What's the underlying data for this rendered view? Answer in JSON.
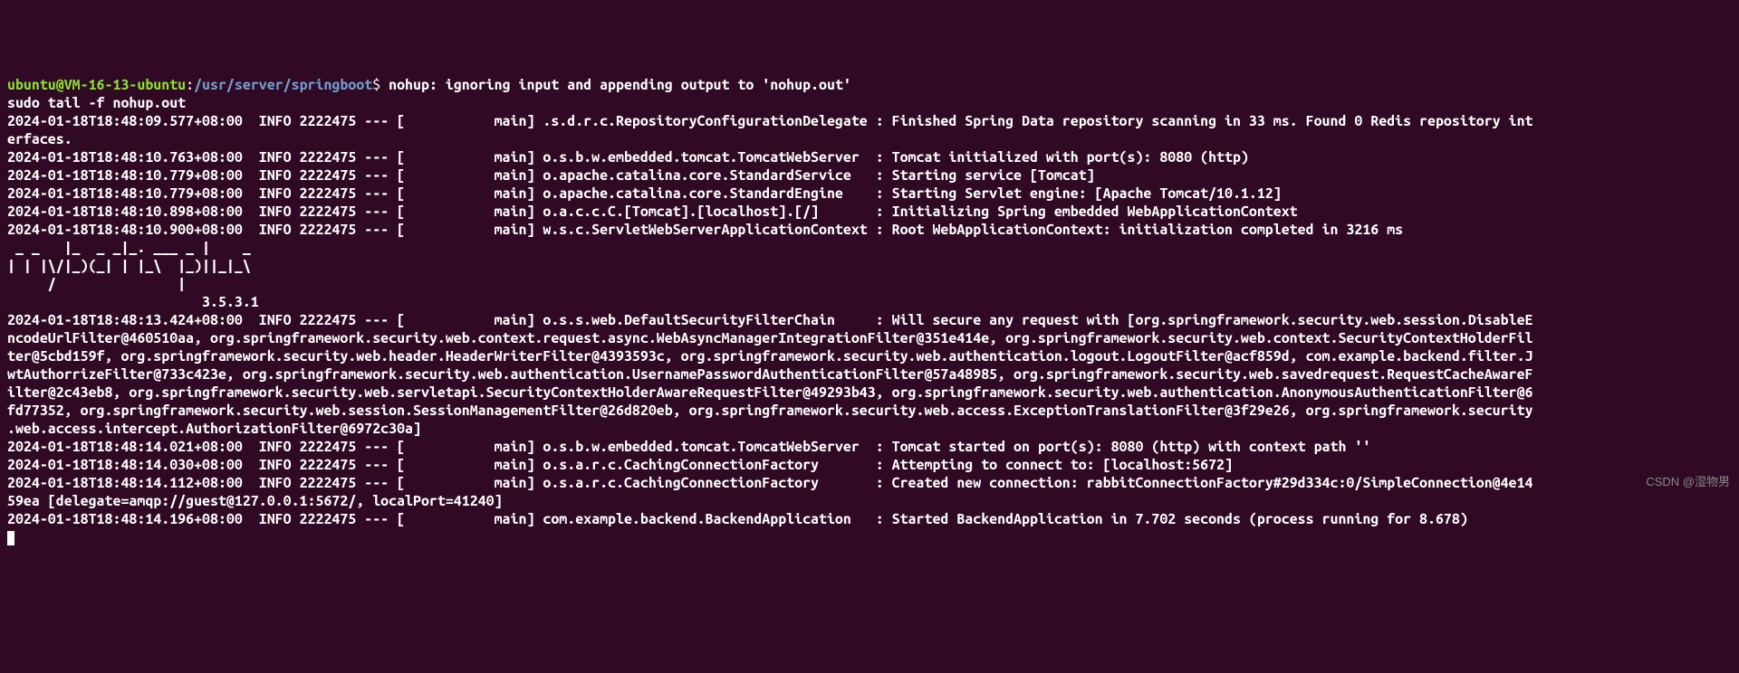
{
  "prompt": {
    "user": "ubuntu@VM-16-13-ubuntu",
    "colon": ":",
    "path": "/usr/server/springboot",
    "dollar": "$ ",
    "command": "nohup: ignoring input and appending output to 'nohup.out'"
  },
  "lines": [
    "sudo tail -f nohup.out",
    "2024-01-18T18:48:09.577+08:00  INFO 2222475 --- [           main] .s.d.r.c.RepositoryConfigurationDelegate : Finished Spring Data repository scanning in 33 ms. Found 0 Redis repository int",
    "erfaces.",
    "2024-01-18T18:48:10.763+08:00  INFO 2222475 --- [           main] o.s.b.w.embedded.tomcat.TomcatWebServer  : Tomcat initialized with port(s): 8080 (http)",
    "2024-01-18T18:48:10.779+08:00  INFO 2222475 --- [           main] o.apache.catalina.core.StandardService   : Starting service [Tomcat]",
    "2024-01-18T18:48:10.779+08:00  INFO 2222475 --- [           main] o.apache.catalina.core.StandardEngine    : Starting Servlet engine: [Apache Tomcat/10.1.12]",
    "2024-01-18T18:48:10.898+08:00  INFO 2222475 --- [           main] o.a.c.c.C.[Tomcat].[localhost].[/]       : Initializing Spring embedded WebApplicationContext",
    "2024-01-18T18:48:10.900+08:00  INFO 2222475 --- [           main] w.s.c.ServletWebServerApplicationContext : Root WebApplicationContext: initialization completed in 3216 ms",
    " _ _   |_  _ _|_. ___ _ |    _ ",
    "| | |\\/|_)(_| | |_\\  |_)||_|_\\ ",
    "     /               |         ",
    "                        3.5.3.1 ",
    "2024-01-18T18:48:13.424+08:00  INFO 2222475 --- [           main] o.s.s.web.DefaultSecurityFilterChain     : Will secure any request with [org.springframework.security.web.session.DisableE",
    "ncodeUrlFilter@460510aa, org.springframework.security.web.context.request.async.WebAsyncManagerIntegrationFilter@351e414e, org.springframework.security.web.context.SecurityContextHolderFil",
    "ter@5cbd159f, org.springframework.security.web.header.HeaderWriterFilter@4393593c, org.springframework.security.web.authentication.logout.LogoutFilter@acf859d, com.example.backend.filter.J",
    "wtAuthorrizeFilter@733c423e, org.springframework.security.web.authentication.UsernamePasswordAuthenticationFilter@57a48985, org.springframework.security.web.savedrequest.RequestCacheAwareF",
    "ilter@2c43eb8, org.springframework.security.web.servletapi.SecurityContextHolderAwareRequestFilter@49293b43, org.springframework.security.web.authentication.AnonymousAuthenticationFilter@6",
    "fd77352, org.springframework.security.web.session.SessionManagementFilter@26d820eb, org.springframework.security.web.access.ExceptionTranslationFilter@3f29e26, org.springframework.security",
    ".web.access.intercept.AuthorizationFilter@6972c30a]",
    "2024-01-18T18:48:14.021+08:00  INFO 2222475 --- [           main] o.s.b.w.embedded.tomcat.TomcatWebServer  : Tomcat started on port(s): 8080 (http) with context path ''",
    "2024-01-18T18:48:14.030+08:00  INFO 2222475 --- [           main] o.s.a.r.c.CachingConnectionFactory       : Attempting to connect to: [localhost:5672]",
    "2024-01-18T18:48:14.112+08:00  INFO 2222475 --- [           main] o.s.a.r.c.CachingConnectionFactory       : Created new connection: rabbitConnectionFactory#29d334c:0/SimpleConnection@4e14",
    "59ea [delegate=amqp://guest@127.0.0.1:5672/, localPort=41240]",
    "2024-01-18T18:48:14.196+08:00  INFO 2222475 --- [           main] com.example.backend.BackendApplication   : Started BackendApplication in 7.702 seconds (process running for 8.678)"
  ],
  "watermark": "CSDN @湿物男"
}
